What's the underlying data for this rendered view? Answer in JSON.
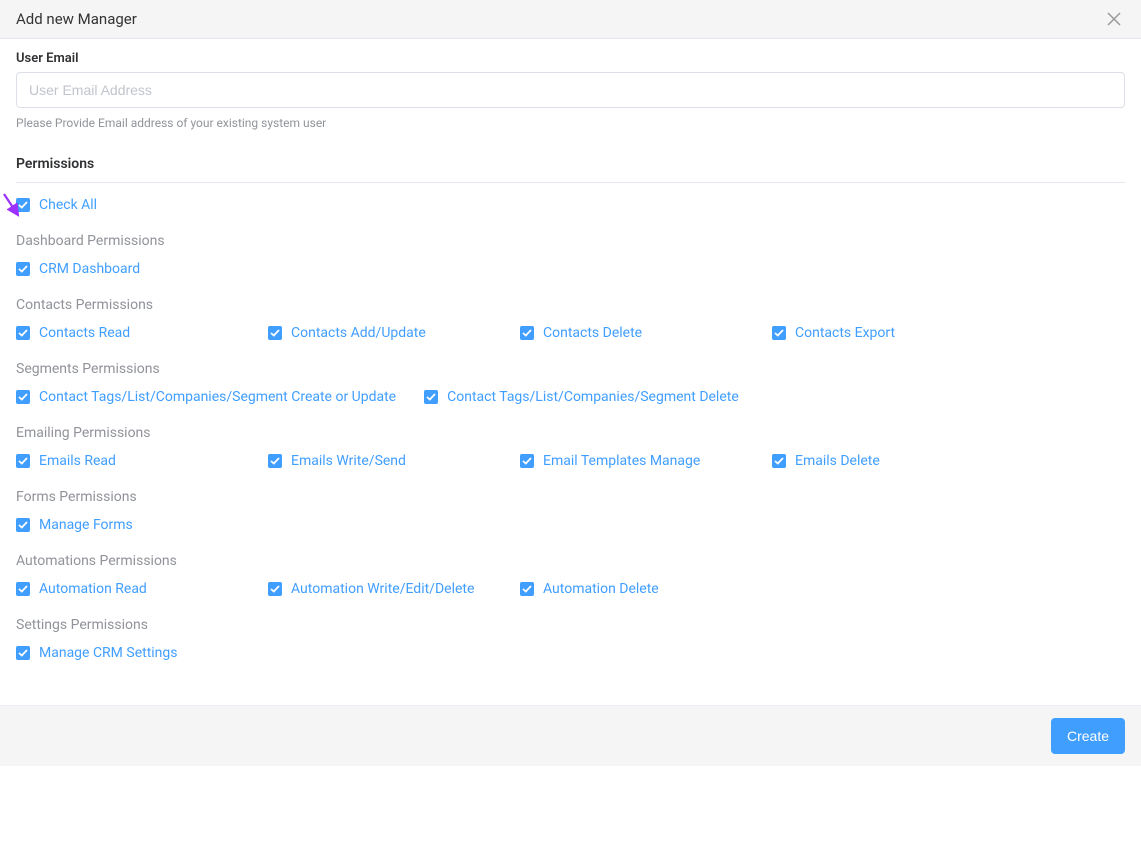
{
  "modal": {
    "title": "Add new Manager"
  },
  "email": {
    "label": "User Email",
    "placeholder": "User Email Address",
    "helper": "Please Provide Email address of your existing system user"
  },
  "permissions_title": "Permissions",
  "check_all_label": "Check All",
  "groups": {
    "dashboard": {
      "title": "Dashboard Permissions",
      "items": [
        "CRM Dashboard"
      ]
    },
    "contacts": {
      "title": "Contacts Permissions",
      "items": [
        "Contacts Read",
        "Contacts Add/Update",
        "Contacts Delete",
        "Contacts Export"
      ]
    },
    "segments": {
      "title": "Segments Permissions",
      "items": [
        "Contact Tags/List/Companies/Segment Create or Update",
        "Contact Tags/List/Companies/Segment Delete"
      ]
    },
    "emailing": {
      "title": "Emailing Permissions",
      "items": [
        "Emails Read",
        "Emails Write/Send",
        "Email Templates Manage",
        "Emails Delete"
      ]
    },
    "forms": {
      "title": "Forms Permissions",
      "items": [
        "Manage Forms"
      ]
    },
    "automations": {
      "title": "Automations Permissions",
      "items": [
        "Automation Read",
        "Automation Write/Edit/Delete",
        "Automation Delete"
      ]
    },
    "settings": {
      "title": "Settings Permissions",
      "items": [
        "Manage CRM Settings"
      ]
    }
  },
  "create_label": "Create",
  "colors": {
    "accent": "#409eff"
  }
}
